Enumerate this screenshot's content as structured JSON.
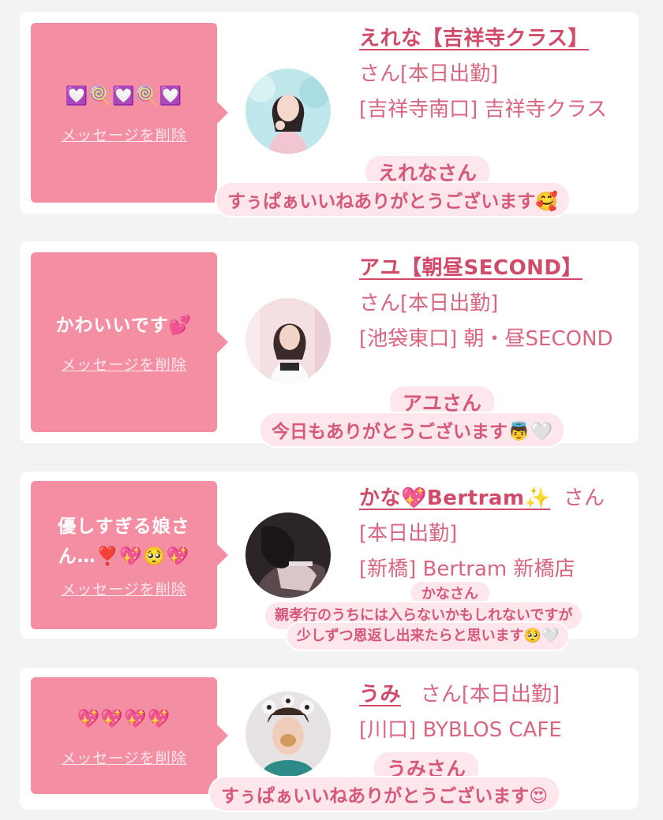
{
  "colors": {
    "bubble": "#f48ea3",
    "link": "#d24a6a",
    "text": "#d9657f",
    "caption_bg": "#fde6ec",
    "caption_text": "#d6587a"
  },
  "delete_label": "メッセージを削除",
  "cards": [
    {
      "message": "💟🍭💟🍭💟",
      "name": "えれな【吉祥寺クラス】",
      "san": "さん[本日出勤]",
      "location": "[吉祥寺南口] 吉祥寺クラス",
      "caption_name": "えれなさん",
      "caption_text": "すぅぱぁいいねありがとうございます🥰"
    },
    {
      "message": "かわいいです💕",
      "name": "アユ【朝昼SECOND】",
      "san": "さん[本日出勤]",
      "location": "[池袋東口] 朝・昼SECOND",
      "caption_name": "アユさん",
      "caption_text": "今日もありがとうございます👼🤍"
    },
    {
      "message": "優しすぎる娘さん…❣️💖🥺💖",
      "name": "かな💖Bertram✨",
      "san": "さん",
      "status": "[本日出勤]",
      "location": "[新橋] Bertram 新橋店",
      "caption_name": "かなさん",
      "caption_line1": "親孝行のうちには入らないかもしれないですが",
      "caption_line2": "少しずつ恩返し出来たらと思います🥺🤍"
    },
    {
      "message": "💖💖💖💖",
      "name": "うみ",
      "san": "さん[本日出勤]",
      "location": "[川口] BYBLOS CAFE",
      "caption_name": "うみさん",
      "caption_text": "すぅぱぁいいねありがとうございます😍"
    }
  ]
}
